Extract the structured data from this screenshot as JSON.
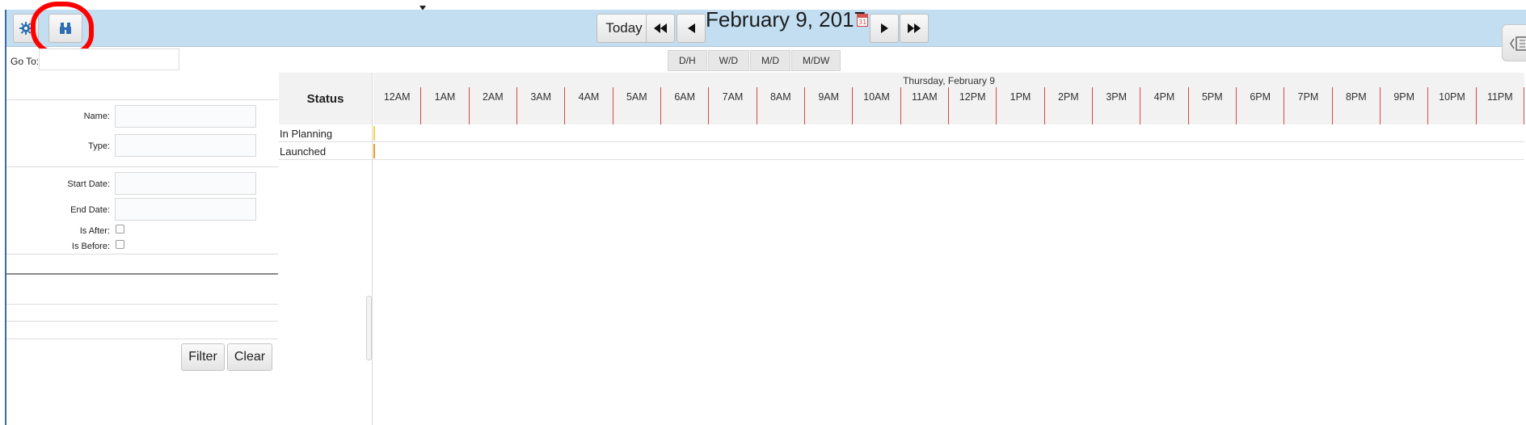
{
  "toolbar": {
    "today_label": "Today",
    "date_title": "February 9, 2017",
    "calendar_day": "31",
    "settings_icon": "gear-icon",
    "search_icon": "binoculars-icon",
    "highlight_color": "#ff0000"
  },
  "views": [
    "D/H",
    "W/D",
    "M/D",
    "M/DW"
  ],
  "filter": {
    "goto_label": "Go To:",
    "goto_value": "",
    "name_label": "Name:",
    "type_label": "Type:",
    "start_date_label": "Start Date:",
    "end_date_label": "End Date:",
    "is_after_label": "Is After:",
    "is_before_label": "Is Before:",
    "filter_label": "Filter",
    "clear_label": "Clear"
  },
  "timeline": {
    "status_header": "Status",
    "day_label": "Thursday, February 9",
    "hours": [
      "12AM",
      "1AM",
      "2AM",
      "3AM",
      "4AM",
      "5AM",
      "6AM",
      "7AM",
      "8AM",
      "9AM",
      "10AM",
      "11AM",
      "12PM",
      "1PM",
      "2PM",
      "3PM",
      "4PM",
      "5PM",
      "6PM",
      "7PM",
      "8PM",
      "9PM",
      "10PM",
      "11PM"
    ],
    "rows": [
      {
        "label": "In Planning",
        "color": "#f2d54a"
      },
      {
        "label": "Launched",
        "color": "#e2a12a"
      }
    ]
  },
  "colors": {
    "topbar": "#c3def0",
    "hour_divider": "#d04a4a"
  }
}
